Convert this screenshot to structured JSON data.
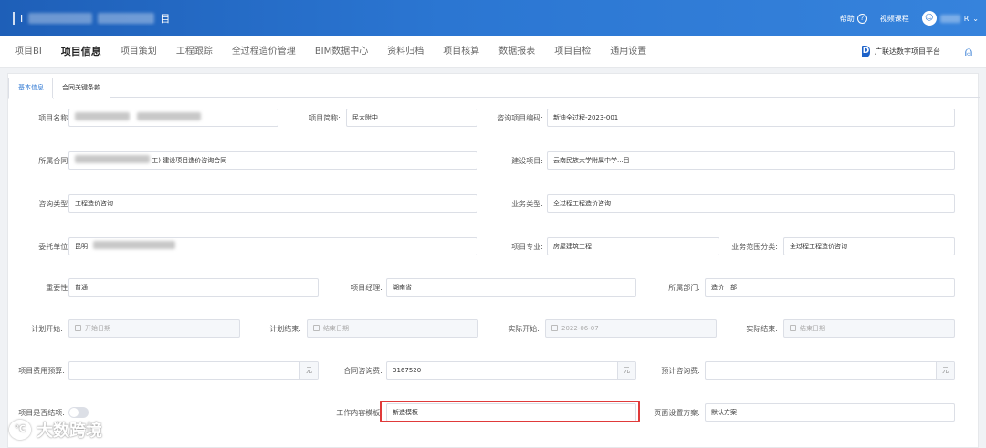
{
  "topbar": {
    "title_prefix": "I",
    "title_suffix": "目",
    "help_label": "帮助",
    "video_label": "视频课程",
    "user_suffix": "R"
  },
  "menu": {
    "items": [
      "项目BI",
      "项目信息",
      "项目策划",
      "工程跟踪",
      "全过程造价管理",
      "BIM数据中心",
      "资料归档",
      "项目核算",
      "数据报表",
      "项目自检",
      "通用设置"
    ],
    "active_index": 1,
    "platform_logo": "D",
    "platform_label": "广联达数字项目平台"
  },
  "subtabs": [
    "基本信息",
    "合同关键条款"
  ],
  "form": {
    "project_name": {
      "label": "项目名称:"
    },
    "project_short": {
      "label": "项目简称:",
      "value": "民大附中"
    },
    "consult_code": {
      "label": "咨询项目编码:",
      "value": "新迪全过程-2023-001"
    },
    "contract": {
      "label": "所属合同:",
      "value": "工) 建设项目造价咨询合同"
    },
    "construction_project": {
      "label": "建设项目:",
      "value": "云南民族大学附属中学...目"
    },
    "consult_type": {
      "label": "咨询类型:",
      "value": "工程造价咨询"
    },
    "business_type": {
      "label": "业务类型:",
      "value": "全过程工程造价咨询"
    },
    "client": {
      "label": "委托单位:",
      "value": "昆明"
    },
    "specialty": {
      "label": "项目专业:",
      "value": "房屋建筑工程"
    },
    "business_scope": {
      "label": "业务范围分类:",
      "value": "全过程工程造价咨询"
    },
    "importance": {
      "label": "重要性:",
      "value": "普通"
    },
    "manager": {
      "label": "项目经理:",
      "value": "湖南省"
    },
    "department": {
      "label": "所属部门:",
      "value": "造价一部"
    },
    "plan_start": {
      "label": "计划开始:",
      "placeholder": "开始日期"
    },
    "plan_end": {
      "label": "计划结束:",
      "placeholder": "结束日期"
    },
    "actual_start": {
      "label": "实际开始:",
      "value": "2022-06-07"
    },
    "actual_end": {
      "label": "实际结束:",
      "placeholder": "结束日期"
    },
    "budget": {
      "label": "项目费用预算:",
      "unit": "元"
    },
    "contract_fee": {
      "label": "合同咨询费:",
      "value": "3167520",
      "unit": "元"
    },
    "estimated_fee": {
      "label": "预计咨询费:",
      "unit": "元"
    },
    "is_closed": {
      "label": "项目是否结项:"
    },
    "work_template": {
      "label": "工作内容模板:",
      "value": "新造模板"
    },
    "page_scheme": {
      "label": "页面设置方案:",
      "value": "默认方案"
    }
  },
  "watermark": {
    "text": "大数跨境",
    "logo": "℃"
  }
}
